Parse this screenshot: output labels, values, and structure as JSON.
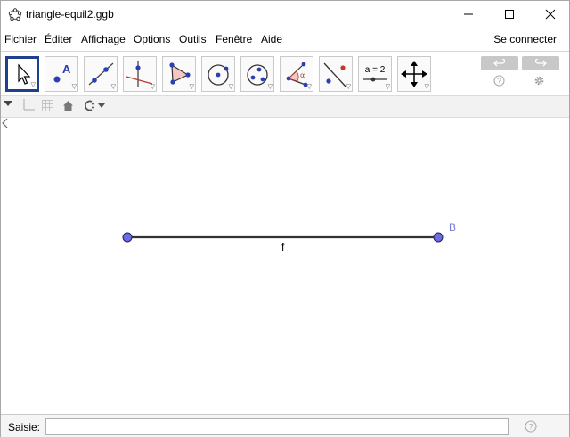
{
  "window": {
    "title": "triangle-equil2.ggb"
  },
  "menu": {
    "items": [
      "Fichier",
      "Éditer",
      "Affichage",
      "Options",
      "Outils",
      "Fenêtre",
      "Aide"
    ],
    "signin": "Se connecter"
  },
  "toolbar": {
    "tools": [
      {
        "icon": "move-arrow-icon",
        "selected": true
      },
      {
        "icon": "point-icon"
      },
      {
        "icon": "line-icon"
      },
      {
        "icon": "perpendicular-line-icon"
      },
      {
        "icon": "polygon-icon"
      },
      {
        "icon": "circle-center-point-icon"
      },
      {
        "icon": "circle-three-points-icon"
      },
      {
        "icon": "angle-icon"
      },
      {
        "icon": "reflect-icon"
      },
      {
        "icon": "slider-icon",
        "label": "a = 2"
      },
      {
        "icon": "move-graphics-view-icon"
      }
    ]
  },
  "graphics": {
    "point_label_B": "B",
    "segment_label": "f"
  },
  "inputbar": {
    "label": "Saisie:",
    "value": ""
  },
  "colors": {
    "point_fill": "#6c6ce0",
    "point_label": "#7b7bd6",
    "selected_tool_border": "#1f3f8f"
  }
}
